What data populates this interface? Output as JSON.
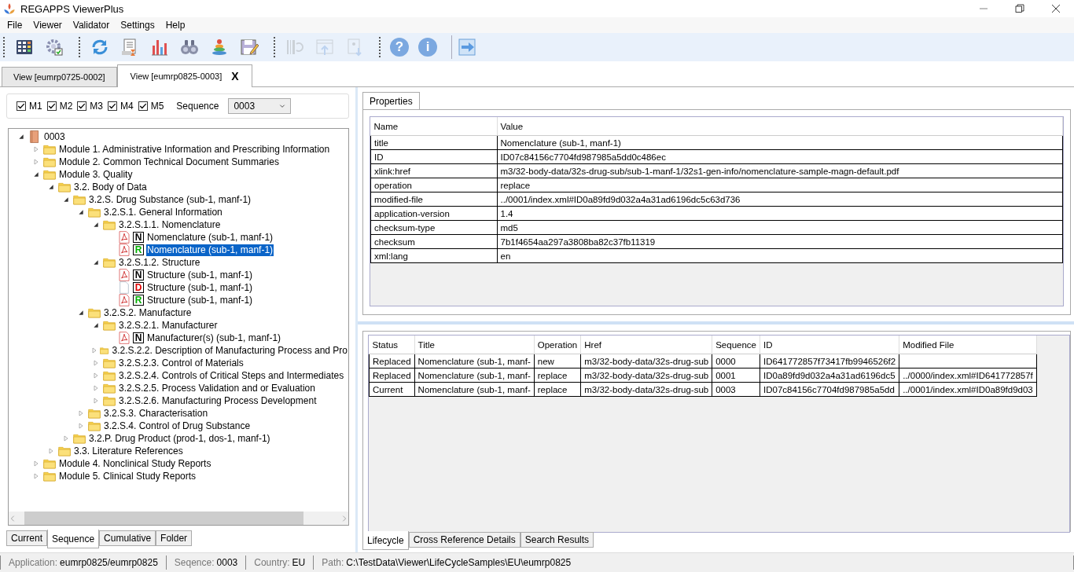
{
  "window": {
    "title": "REGAPPS ViewerPlus"
  },
  "menu": [
    "File",
    "Viewer",
    "Validator",
    "Settings",
    "Help"
  ],
  "toolbar": [
    {
      "kind": "grip",
      "buttons": [
        {
          "disabled": false
        },
        {
          "disabled": false
        }
      ]
    },
    {
      "kind": "grip",
      "buttons": [
        {
          "disabled": false
        },
        {
          "disabled": false
        },
        {
          "disabled": false
        },
        {
          "disabled": false
        },
        {
          "disabled": false
        },
        {
          "disabled": false
        }
      ]
    },
    {
      "kind": "grip",
      "buttons": [
        {
          "disabled": true
        },
        {
          "disabled": true
        },
        {
          "disabled": true
        }
      ]
    },
    {
      "kind": "grip",
      "buttons": [
        {
          "disabled": false,
          "glyph": "?"
        },
        {
          "disabled": false,
          "glyph": "i"
        }
      ]
    },
    {
      "kind": "plain",
      "buttons": [
        {
          "disabled": false
        }
      ]
    }
  ],
  "view_tabs": [
    {
      "label": "View [eumrp0725-0002]",
      "selected": false
    },
    {
      "label": "View [eumrp0825-0003]",
      "selected": true,
      "close": "X"
    }
  ],
  "filters": {
    "modules": [
      {
        "label": "M1",
        "checked": true
      },
      {
        "label": "M2",
        "checked": true
      },
      {
        "label": "M3",
        "checked": true
      },
      {
        "label": "M4",
        "checked": true
      },
      {
        "label": "M5",
        "checked": true
      }
    ],
    "sequence_label": "Sequence",
    "sequence_value": "0003"
  },
  "tree": [
    {
      "label": "0003",
      "kind": "root",
      "expanded": true,
      "selected": false,
      "children": [
        {
          "label": "Module 1. Administrative Information and Prescribing Information",
          "kind": "folder",
          "expanded": false,
          "selected": false
        },
        {
          "label": "Module 2. Common Technical Document Summaries",
          "kind": "folder",
          "expanded": false,
          "selected": false
        },
        {
          "label": "Module 3. Quality",
          "kind": "folder",
          "expanded": true,
          "selected": false,
          "children": [
            {
              "label": "3.2. Body of Data",
              "kind": "folder",
              "expanded": true,
              "selected": false,
              "children": [
                {
                  "label": "3.2.S. Drug Substance (sub-1, manf-1)",
                  "kind": "folder",
                  "expanded": true,
                  "selected": false,
                  "children": [
                    {
                      "label": "3.2.S.1. General Information",
                      "kind": "folder",
                      "expanded": true,
                      "selected": false,
                      "children": [
                        {
                          "label": "3.2.S.1.1. Nomenclature",
                          "kind": "folder",
                          "expanded": true,
                          "selected": false,
                          "children": [
                            {
                              "label": "Nomenclature (sub-1, manf-1)",
                              "kind": "pdf",
                              "op": "N",
                              "color": "#000000",
                              "selected": false
                            },
                            {
                              "label": "Nomenclature (sub-1, manf-1)",
                              "kind": "pdf",
                              "op": "R",
                              "color": "#00b000",
                              "selected": true
                            }
                          ]
                        },
                        {
                          "label": "3.2.S.1.2. Structure",
                          "kind": "folder",
                          "expanded": true,
                          "selected": false,
                          "children": [
                            {
                              "label": "Structure (sub-1, manf-1)",
                              "kind": "pdf",
                              "op": "N",
                              "color": "#000000",
                              "selected": false
                            },
                            {
                              "label": "Structure (sub-1, manf-1)",
                              "kind": "deleted",
                              "op": "D",
                              "color": "#e00000",
                              "selected": false
                            },
                            {
                              "label": "Structure (sub-1, manf-1)",
                              "kind": "pdf",
                              "op": "R",
                              "color": "#00b000",
                              "selected": false
                            }
                          ]
                        }
                      ]
                    },
                    {
                      "label": "3.2.S.2. Manufacture",
                      "kind": "folder",
                      "expanded": true,
                      "selected": false,
                      "children": [
                        {
                          "label": "3.2.S.2.1. Manufacturer",
                          "kind": "folder",
                          "expanded": true,
                          "selected": false,
                          "children": [
                            {
                              "label": "Manufacturer(s) (sub-1, manf-1)",
                              "kind": "pdf",
                              "op": "N",
                              "color": "#000000",
                              "selected": false
                            }
                          ]
                        },
                        {
                          "label": "3.2.S.2.2. Description of Manufacturing Process and Pro",
                          "kind": "folder",
                          "expanded": false,
                          "selected": false
                        },
                        {
                          "label": "3.2.S.2.3. Control of Materials",
                          "kind": "folder",
                          "expanded": false,
                          "selected": false
                        },
                        {
                          "label": "3.2.S.2.4. Controls of Critical Steps and Intermediates",
                          "kind": "folder",
                          "expanded": false,
                          "selected": false
                        },
                        {
                          "label": "3.2.S.2.5. Process Validation and or Evaluation",
                          "kind": "folder",
                          "expanded": false,
                          "selected": false
                        },
                        {
                          "label": "3.2.S.2.6. Manufacturing Process Development",
                          "kind": "folder",
                          "expanded": false,
                          "selected": false
                        }
                      ]
                    },
                    {
                      "label": "3.2.S.3. Characterisation",
                      "kind": "folder",
                      "expanded": false,
                      "selected": false
                    },
                    {
                      "label": "3.2.S.4. Control of Drug Substance",
                      "kind": "folder",
                      "expanded": false,
                      "selected": false
                    }
                  ]
                },
                {
                  "label": "3.2.P. Drug Product (prod-1, dos-1, manf-1)",
                  "kind": "folder",
                  "expanded": false,
                  "selected": false
                }
              ]
            },
            {
              "label": "3.3. Literature References",
              "kind": "folder",
              "expanded": false,
              "selected": false
            }
          ]
        },
        {
          "label": "Module 4. Nonclinical Study Reports",
          "kind": "folder",
          "expanded": false,
          "selected": false
        },
        {
          "label": "Module 5. Clinical Study Reports",
          "kind": "folder",
          "expanded": false,
          "selected": false
        }
      ]
    }
  ],
  "left_tabs": [
    {
      "label": "Current",
      "selected": false
    },
    {
      "label": "Sequence",
      "selected": true
    },
    {
      "label": "Cumulative",
      "selected": false
    },
    {
      "label": "Folder",
      "selected": false
    }
  ],
  "properties": {
    "tab": {
      "label": "Properties",
      "selected": true
    },
    "columns": [
      "Name",
      "Value"
    ],
    "rows": [
      {
        "name": "title",
        "value": "Nomenclature (sub-1, manf-1)"
      },
      {
        "name": "ID",
        "value": "ID07c84156c7704fd987985a5dd0c486ec"
      },
      {
        "name": "xlink:href",
        "value": "m3/32-body-data/32s-drug-sub/sub-1-manf-1/32s1-gen-info/nomenclature-sample-magn-default.pdf"
      },
      {
        "name": "operation",
        "value": "replace"
      },
      {
        "name": "modified-file",
        "value": "../0001/index.xml#ID0a89fd9d032a4a31ad6196dc5c63d736"
      },
      {
        "name": "application-version",
        "value": "1.4"
      },
      {
        "name": "checksum-type",
        "value": "md5"
      },
      {
        "name": "checksum",
        "value": "7b1f4654aa297a3808ba82c37fb11319"
      },
      {
        "name": "xml:lang",
        "value": "en"
      }
    ]
  },
  "lifecycle": {
    "columns": [
      "Status",
      "Title",
      "Operation",
      "Href",
      "Sequence",
      "ID",
      "Modified File"
    ],
    "rows": [
      {
        "status": "Replaced",
        "title": "Nomenclature (sub-1, manf-",
        "operation": "new",
        "href": "m3/32-body-data/32s-drug-sub",
        "sequence": "0000",
        "id": "ID641772857f73417fb9946526f2"
      },
      {
        "status": "Replaced",
        "title": "Nomenclature (sub-1, manf-",
        "operation": "replace",
        "href": "m3/32-body-data/32s-drug-sub",
        "sequence": "0001",
        "id": "ID0a89fd9d032a4a31ad6196dc5",
        "modified_file": "../0000/index.xml#ID641772857f"
      },
      {
        "status": "Current",
        "title": "Nomenclature (sub-1, manf-",
        "operation": "replace",
        "href": "m3/32-body-data/32s-drug-sub",
        "sequence": "0003",
        "id": "ID07c84156c7704fd987985a5dd",
        "modified_file": "../0001/index.xml#ID0a89fd9d03"
      }
    ]
  },
  "right_tabs": [
    {
      "label": "Lifecycle",
      "selected": true
    },
    {
      "label": "Cross Reference Details",
      "selected": false
    },
    {
      "label": "Search Results",
      "selected": false
    }
  ],
  "status_bar": [
    {
      "label": "Application:",
      "value": "eumrp0825/eumrp0825"
    },
    {
      "label": "Seqence:",
      "value": "0003"
    },
    {
      "label": "Country:",
      "value": "EU"
    },
    {
      "label": "Path:",
      "value": "C:\\TestData\\Viewer\\LifeCycleSamples\\EU\\eumrp0825"
    }
  ]
}
